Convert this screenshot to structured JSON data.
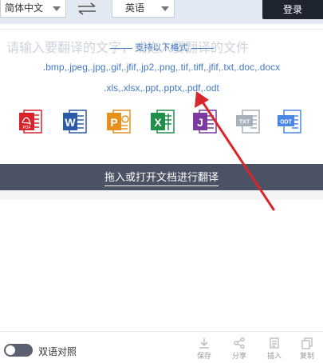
{
  "toolbar": {
    "source_language": "简体中文",
    "target_language": "英语",
    "login_label": "登录"
  },
  "dropzone": {
    "watermark_text": "请输入要翻译的文字，或拖入要翻译的文件",
    "formats_title": "支持以下格式",
    "formats_line1": ".bmp,.jpeg,.jpg,.gif,.jfif,.jp2,.png,.tif,.tiff,.jfif,.txt,.doc,.docx",
    "formats_line2": ".xls,.xlsx,.ppt,.pptx,.pdf,.odt",
    "file_icons": [
      {
        "name": "pdf-file-icon",
        "label": "PDF",
        "color": "#d8232a"
      },
      {
        "name": "word-file-icon",
        "label": "W",
        "color": "#2b5aa8"
      },
      {
        "name": "powerpoint-file-icon",
        "label": "P",
        "color": "#e8901e"
      },
      {
        "name": "excel-file-icon",
        "label": "X",
        "color": "#1f8f4a"
      },
      {
        "name": "onenote-file-icon",
        "label": "J",
        "color": "#7a3aa0"
      },
      {
        "name": "txt-file-icon",
        "label": "TXT",
        "color": "#a8b0bb"
      },
      {
        "name": "odt-file-icon",
        "label": "ODT",
        "color": "#4a86e8"
      }
    ],
    "action_label": "拖入或打开文档进行翻译"
  },
  "bottom": {
    "bilingual_label": "双语对照",
    "tools": {
      "save": "保存",
      "share": "分享",
      "insert": "插入",
      "copy": "复制"
    }
  },
  "colors": {
    "accent_blue": "#4478c4",
    "action_bar": "#4b5263",
    "login_bg": "#1f2530",
    "annotation_arrow": "#d9262c"
  }
}
